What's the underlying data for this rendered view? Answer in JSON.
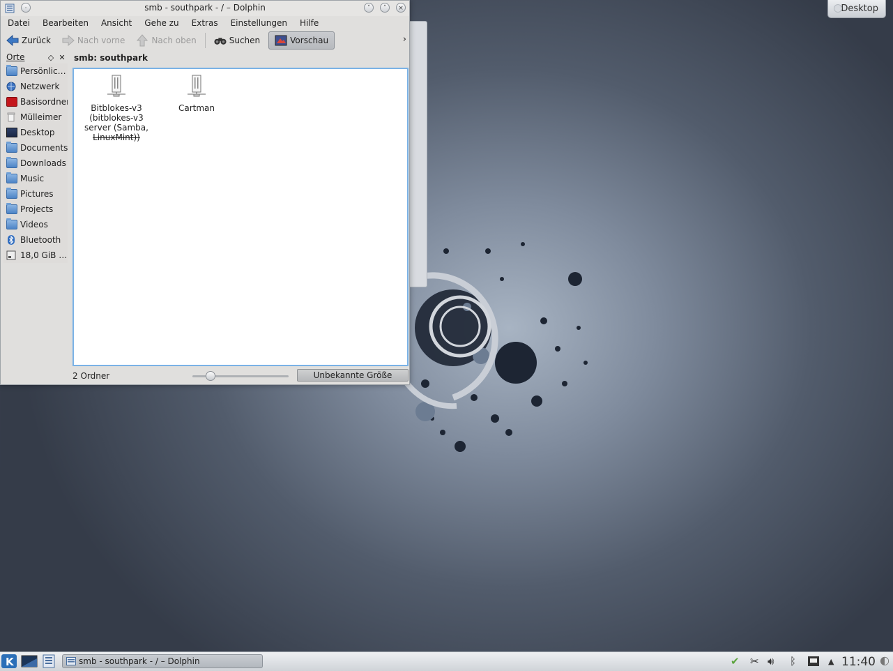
{
  "window": {
    "title": "smb - southpark - / – Dolphin"
  },
  "menu": [
    "Datei",
    "Bearbeiten",
    "Ansicht",
    "Gehe zu",
    "Extras",
    "Einstellungen",
    "Hilfe"
  ],
  "toolbar": {
    "back": "Zurück",
    "forward": "Nach vorne",
    "up": "Nach oben",
    "search": "Suchen",
    "preview": "Vorschau",
    "more": "›"
  },
  "places": {
    "header": "Orte",
    "items": [
      {
        "label": "Persönlic…",
        "icon": "home-folder-icon"
      },
      {
        "label": "Netzwerk",
        "icon": "network-icon"
      },
      {
        "label": "Basisordner",
        "icon": "root-folder-icon"
      },
      {
        "label": "Mülleimer",
        "icon": "trash-icon"
      },
      {
        "label": "Desktop",
        "icon": "desktop-icon"
      },
      {
        "label": "Documents",
        "icon": "folder-icon"
      },
      {
        "label": "Downloads",
        "icon": "folder-icon"
      },
      {
        "label": "Music",
        "icon": "folder-icon"
      },
      {
        "label": "Pictures",
        "icon": "folder-icon"
      },
      {
        "label": "Projects",
        "icon": "folder-icon"
      },
      {
        "label": "Videos",
        "icon": "folder-icon"
      },
      {
        "label": "Bluetooth",
        "icon": "bluetooth-icon"
      },
      {
        "label": "18,0 GiB …",
        "icon": "drive-icon"
      }
    ]
  },
  "view": {
    "location": "smb: southpark",
    "items": [
      {
        "lines": [
          "Bitblokes-v3",
          "(bitblokes-v3",
          "server (Samba,",
          "LinuxMint))"
        ],
        "icon": "network-server-icon"
      },
      {
        "lines": [
          "Cartman"
        ],
        "icon": "network-server-icon"
      }
    ]
  },
  "status": {
    "text": "2 Ordner",
    "space": "Unbekannte Größe",
    "zoom": 0.15
  },
  "desktop": {
    "button": "Desktop"
  },
  "taskbar": {
    "task": "smb - southpark - / – Dolphin",
    "clock": "11:40"
  },
  "colors": {
    "accent": "#7ab2e6",
    "folder": "#4d84c6"
  }
}
